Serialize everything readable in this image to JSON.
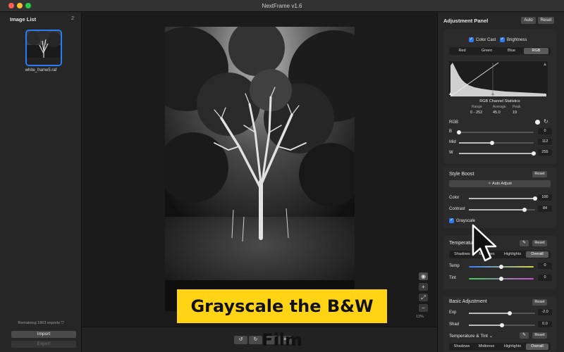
{
  "window": {
    "title": "NextFrame v1.6"
  },
  "sidebar": {
    "title": "Image List",
    "count": "2",
    "thumbnail_name": "white_frame5.raf",
    "remaining": "Remaining 1863 exports",
    "import_label": "Import",
    "export_label": "Export"
  },
  "viewer": {
    "zoom": "13%",
    "caption": "Grayscale the B&W Film"
  },
  "panel": {
    "title": "Adjustment Panel",
    "auto_label": "Auto",
    "reset_label": "Reset",
    "color_cast_label": "Color Cast",
    "brightness_label": "Brightness",
    "channel_tabs": [
      "Red",
      "Green",
      "Blue",
      "RGB"
    ],
    "active_channel": "RGB",
    "stats": {
      "title": "RGB Channel Statistics",
      "range_label": "Range",
      "range_value": "0 - 252",
      "average_label": "Average",
      "average_value": "45.0",
      "peak_label": "Peak",
      "peak_value": "19"
    },
    "levels": {
      "rgb_label": "RGB",
      "b_label": "B",
      "b_value": "0",
      "b_level": 0,
      "mid_label": "Mid",
      "mid_value": "112",
      "mid_level": 0.44,
      "w_label": "W",
      "w_value": "255",
      "w_level": 1.0
    },
    "style_boost": {
      "title": "Style Boost",
      "reset_label": "Reset",
      "auto_adjust_label": "Auto Adjust",
      "color_label": "Color",
      "color_value": "100",
      "color_level": 1.0,
      "contrast_label": "Contrast",
      "contrast_value": "84",
      "contrast_level": 0.84,
      "grayscale_label": "Grayscale"
    },
    "temperature": {
      "title": "Temperature & Tint",
      "reset_label": "Reset",
      "tabs": [
        "Shadows",
        "Midtones",
        "Highlights",
        "Overall"
      ],
      "active_tab": "Overall",
      "temp_label": "Temp",
      "temp_value": "0",
      "tint_label": "Tint",
      "tint_value": "0"
    },
    "basic": {
      "title": "Basic Adjustment",
      "reset_label": "Reset",
      "exp_label": "Exp",
      "exp_value": "-2.0",
      "exp_level": 0.62,
      "shad_label": "Shad",
      "shad_value": "0.0",
      "shad_level": 0.5
    },
    "temperature2": {
      "title": "Temperature & Tint",
      "reset_label": "Reset",
      "tabs": [
        "Shadows",
        "Midtones",
        "Highlights",
        "Overall"
      ],
      "active_tab": "Overall"
    }
  },
  "colors": {
    "accent": "#2b7cf5",
    "caption_bg": "#ffd414"
  }
}
